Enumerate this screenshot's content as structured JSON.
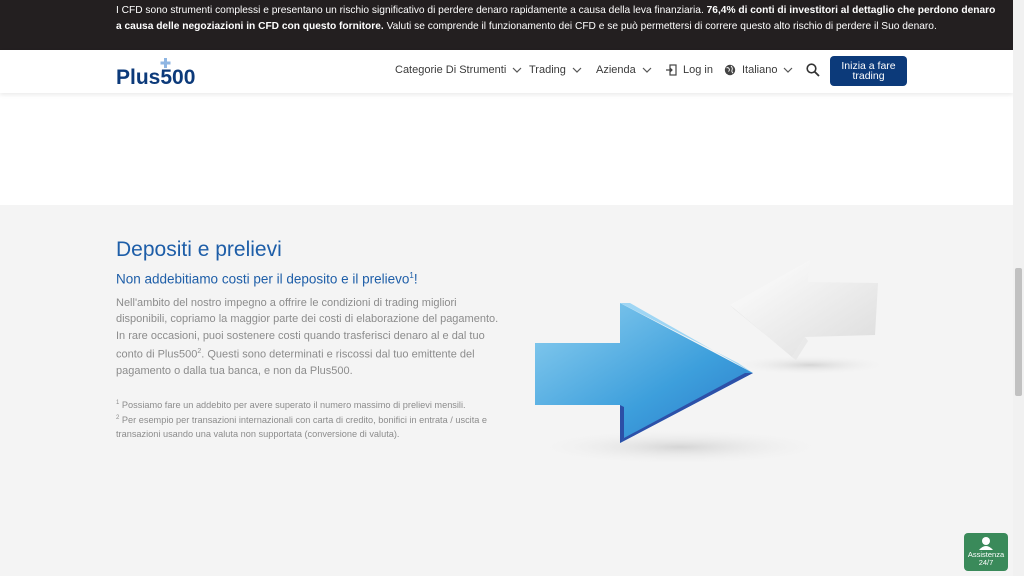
{
  "risk_banner": {
    "part1": "I CFD sono strumenti complessi e presentano un rischio significativo di perdere denaro rapidamente a causa della leva finanziaria. ",
    "part_bold": "76,4% di conti di investitori al dettaglio che perdono denaro a causa delle negoziazioni in CFD con questo fornitore.",
    "part2": " Valuti se comprende il funzionamento dei CFD e se può permettersi di correre questo alto rischio di perdere il Suo denaro."
  },
  "header": {
    "logo_text": "Plus500",
    "nav": {
      "instruments": "Categorie Di Strumenti",
      "trading": "Trading",
      "company": "Azienda",
      "login": "Log in",
      "language": "Italiano"
    },
    "cta_label": "Inizia a fare trading"
  },
  "main": {
    "title": "Depositi e prelievi",
    "subtitle_pre": "Non addebitiamo costi per il deposito e il prelievo",
    "subtitle_sup": "1",
    "subtitle_post": "!",
    "body_1": "Nell'ambito del nostro impegno a offrire le condizioni di trading migliori disponibili, copriamo la maggior parte dei costi di elaborazione del pagamento. In rare occasioni, puoi sostenere costi quando trasferisci denaro al e dal tuo conto di Plus500",
    "body_sup": "2",
    "body_2": ". Questi sono determinati e riscossi dal tuo emittente del pagamento o dalla tua banca, e non da Plus500.",
    "footnote_1_num": "1",
    "footnote_1": " Possiamo fare un addebito per avere superato il numero massimo di prelievi mensili.",
    "footnote_2_num": "2",
    "footnote_2": " Per esempio per transazioni internazionali con carta di credito, bonifici in entrata / uscita e transazioni usando una valuta non supportata (conversione di valuta)."
  },
  "support_widget": {
    "line1": "Assistenza",
    "line2": "24/7"
  },
  "colors": {
    "brand_blue": "#1e5ea8",
    "cta_bg": "#0c3a7a",
    "banner_bg": "#231f20",
    "support_bg": "#3a8a5a"
  }
}
